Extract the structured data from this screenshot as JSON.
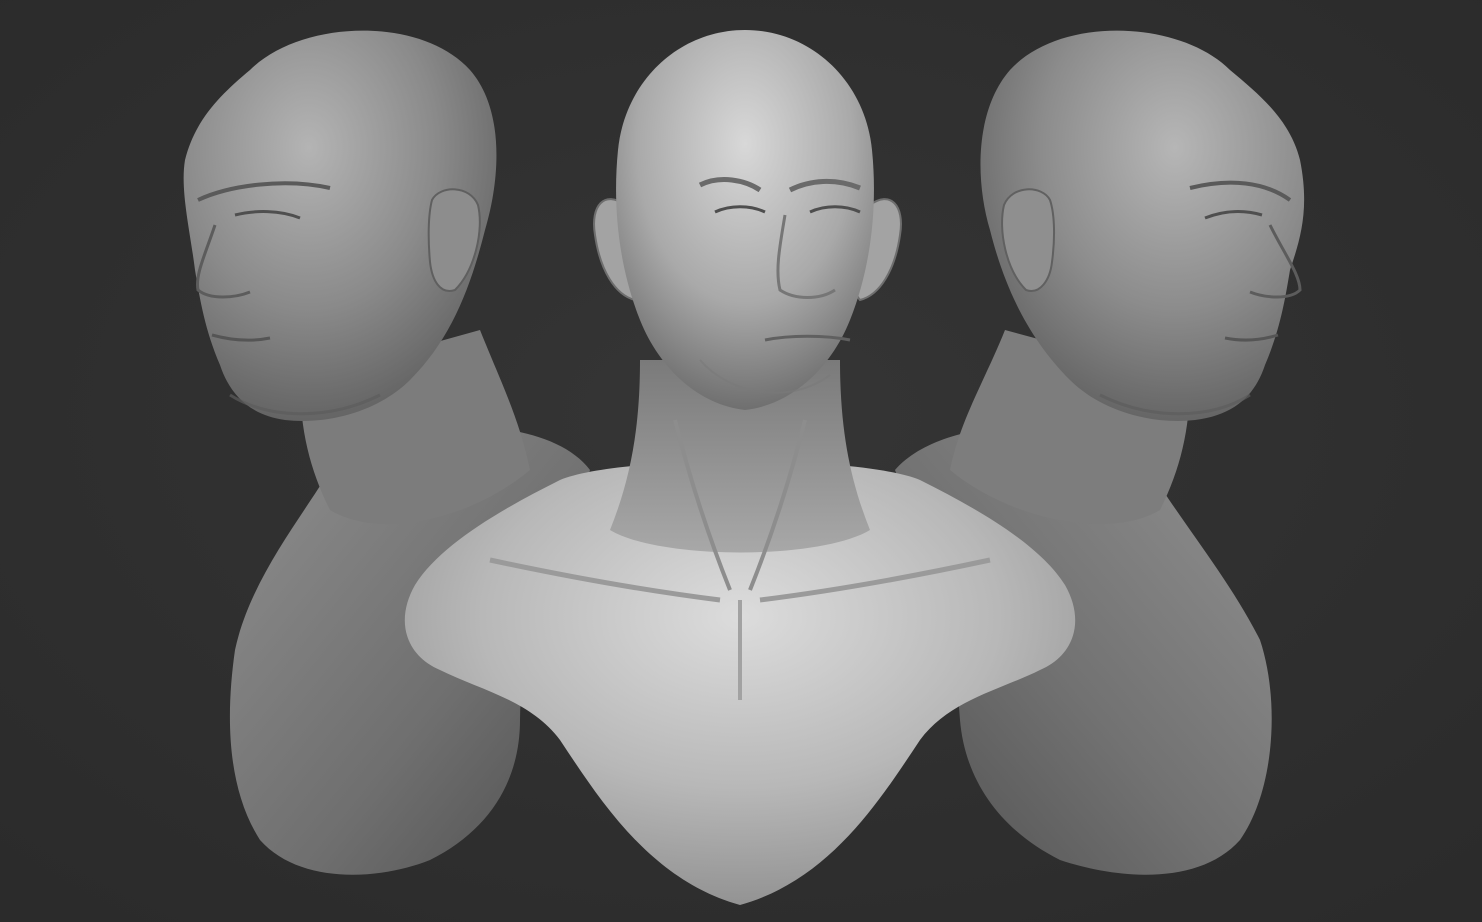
{
  "scene": {
    "background_color": "#2f2f2f",
    "render_material": "gray clay",
    "views": [
      {
        "name": "left-three-quarter-view",
        "facing": "left"
      },
      {
        "name": "front-view",
        "facing": "front"
      },
      {
        "name": "right-profile-view",
        "facing": "right"
      }
    ]
  }
}
